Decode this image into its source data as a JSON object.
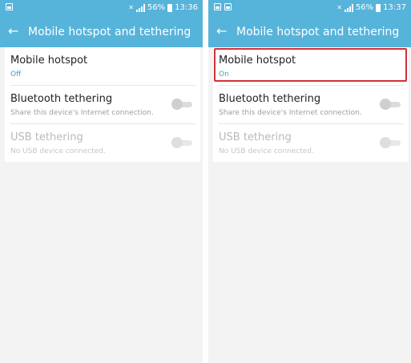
{
  "screens": [
    {
      "status_time": "13:36",
      "status_battery": "56%",
      "title": "Mobile hotspot and tethering",
      "rows": [
        {
          "title": "Mobile hotspot",
          "subtitle": "Off"
        },
        {
          "title": "Bluetooth tethering",
          "subtitle": "Share this device's Internet connection."
        },
        {
          "title": "USB tethering",
          "subtitle": "No USB device connected."
        }
      ]
    },
    {
      "status_time": "13:37",
      "status_battery": "56%",
      "title": "Mobile hotspot and tethering",
      "rows": [
        {
          "title": "Mobile hotspot",
          "subtitle": "On"
        },
        {
          "title": "Bluetooth tethering",
          "subtitle": "Share this device's Internet connection."
        },
        {
          "title": "USB tethering",
          "subtitle": "No USB device connected."
        }
      ]
    }
  ],
  "colors": {
    "accent": "#56b4db",
    "highlight": "#d0313a",
    "link_text": "#3f9fd3"
  },
  "icons": [
    "image-notification-icon",
    "mute-icon",
    "signal-icon",
    "battery-icon",
    "back-arrow-icon"
  ]
}
